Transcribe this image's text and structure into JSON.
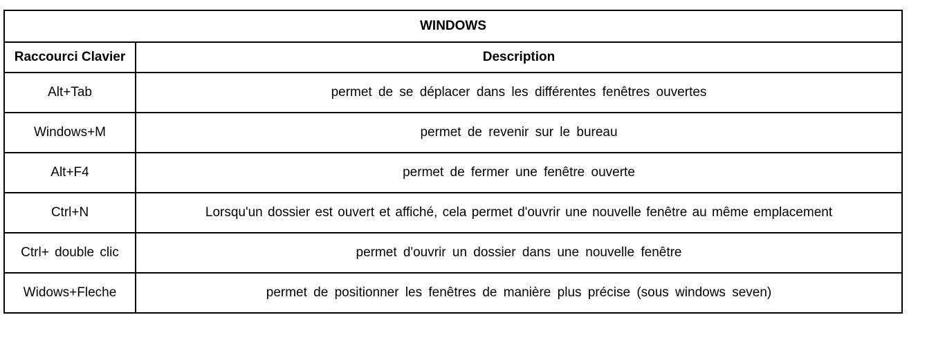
{
  "table": {
    "title": "WINDOWS",
    "headers": {
      "shortcut": "Raccourci Clavier",
      "description": "Description"
    },
    "rows": [
      {
        "shortcut": "Alt+Tab",
        "description": "permet de se déplacer dans les différentes fenêtres ouvertes"
      },
      {
        "shortcut": "Windows+M",
        "description": "permet de revenir sur le bureau"
      },
      {
        "shortcut": "Alt+F4",
        "description": "permet de fermer une fenêtre ouverte"
      },
      {
        "shortcut": "Ctrl+N",
        "description": "Lorsqu'un dossier est ouvert et affiché, cela permet d'ouvrir une nouvelle fenêtre au même emplacement"
      },
      {
        "shortcut": "Ctrl+ double clic",
        "description": "permet d'ouvrir un dossier dans une nouvelle fenêtre"
      },
      {
        "shortcut": "Widows+Fleche",
        "description": "permet de positionner les fenêtres de manière plus précise (sous windows seven)"
      }
    ]
  }
}
